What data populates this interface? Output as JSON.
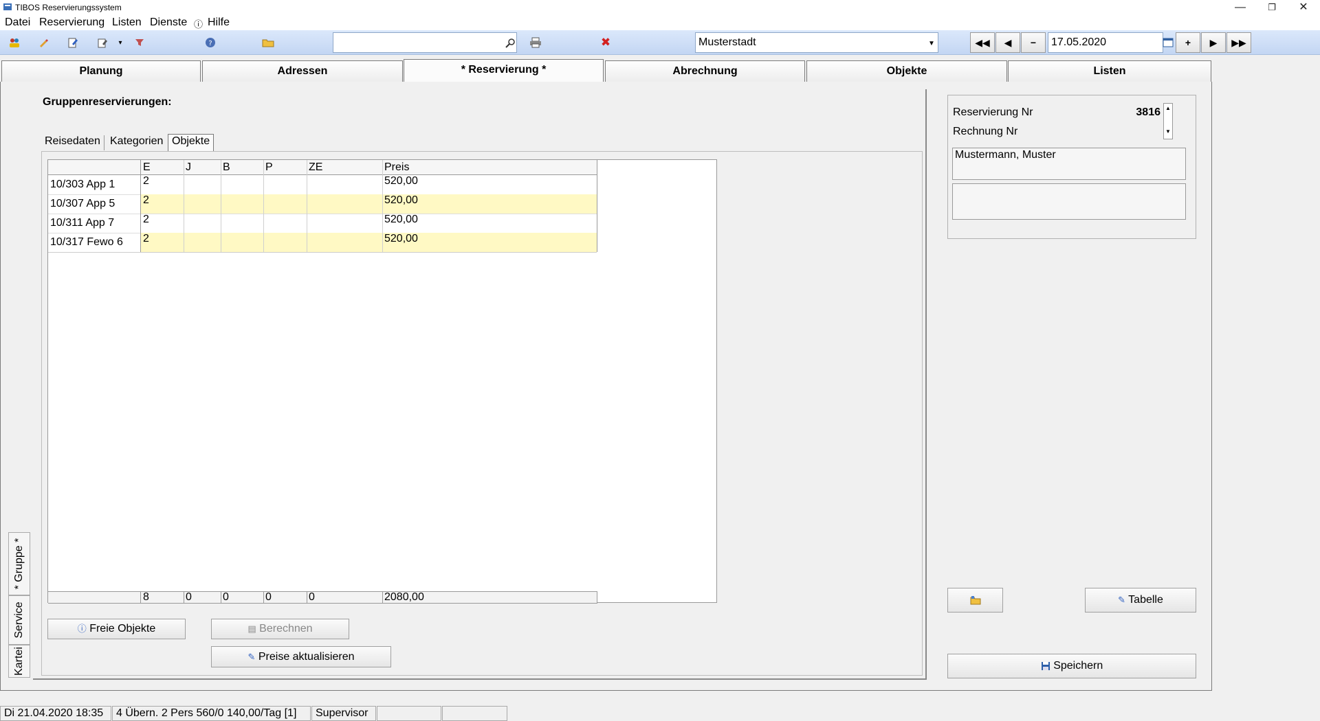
{
  "window": {
    "title": "TIBOS Reservierungssystem",
    "minimize": "—",
    "restore": "❐",
    "close": "✕"
  },
  "menu": [
    {
      "label": "Datei"
    },
    {
      "label": "Reservierung"
    },
    {
      "label": "Listen"
    },
    {
      "label": "Dienste"
    },
    {
      "label": "Hilfe"
    }
  ],
  "toolbar": {
    "search_value": "",
    "location_value": "Musterstadt",
    "date_value": "17.05.2020"
  },
  "tabs": [
    {
      "label": "Planung"
    },
    {
      "label": "Adressen"
    },
    {
      "label": "* Reservierung *"
    },
    {
      "label": "Abrechnung"
    },
    {
      "label": "Objekte"
    },
    {
      "label": "Listen"
    }
  ],
  "side_tabs": [
    {
      "label": "* Gruppe *"
    },
    {
      "label": "Service"
    },
    {
      "label": "Kartei"
    }
  ],
  "section": {
    "heading": "Gruppenreservierungen:"
  },
  "subtabs": [
    {
      "label": "Reisedaten"
    },
    {
      "label": "Kategorien"
    },
    {
      "label": "Objekte"
    }
  ],
  "grid": {
    "columns": [
      "E",
      "J",
      "B",
      "P",
      "ZE",
      "Preis"
    ],
    "rows": [
      {
        "name": "10/303 App 1",
        "cells": [
          "2",
          "",
          "",
          "",
          "",
          "520,00"
        ]
      },
      {
        "name": "10/307 App 5",
        "cells": [
          "2",
          "",
          "",
          "",
          "",
          "520,00"
        ]
      },
      {
        "name": "10/311 App 7",
        "cells": [
          "2",
          "",
          "",
          "",
          "",
          "520,00"
        ]
      },
      {
        "name": "10/317 Fewo 6",
        "cells": [
          "2",
          "",
          "",
          "",
          "",
          "520,00"
        ]
      }
    ],
    "totals": [
      "8",
      "0",
      "0",
      "0",
      "0",
      "2080,00"
    ]
  },
  "buttons": {
    "freie_objekte": "Freie Objekte",
    "berechnen": "Berechnen",
    "preise_aktualisieren": "Preise aktualisieren",
    "tabelle": "Tabelle",
    "speichern": "Speichern"
  },
  "right_panel": {
    "reservierung_label": "Reservierung Nr",
    "reservierung_value": "3816",
    "rechnung_label": "Rechnung Nr",
    "rechnung_value": "",
    "address": "Mustermann, Muster",
    "note": ""
  },
  "status": [
    {
      "text": "Di 21.04.2020 18:35"
    },
    {
      "text": "4 Übern. 2 Pers 560/0  140,00/Tag [1]"
    },
    {
      "text": "Supervisor"
    },
    {
      "text": ""
    },
    {
      "text": ""
    }
  ],
  "colors": {
    "toolbar_top": "#dbe8fb",
    "row_highlight": "#fff9c4",
    "delete_icon": "#d32020"
  }
}
